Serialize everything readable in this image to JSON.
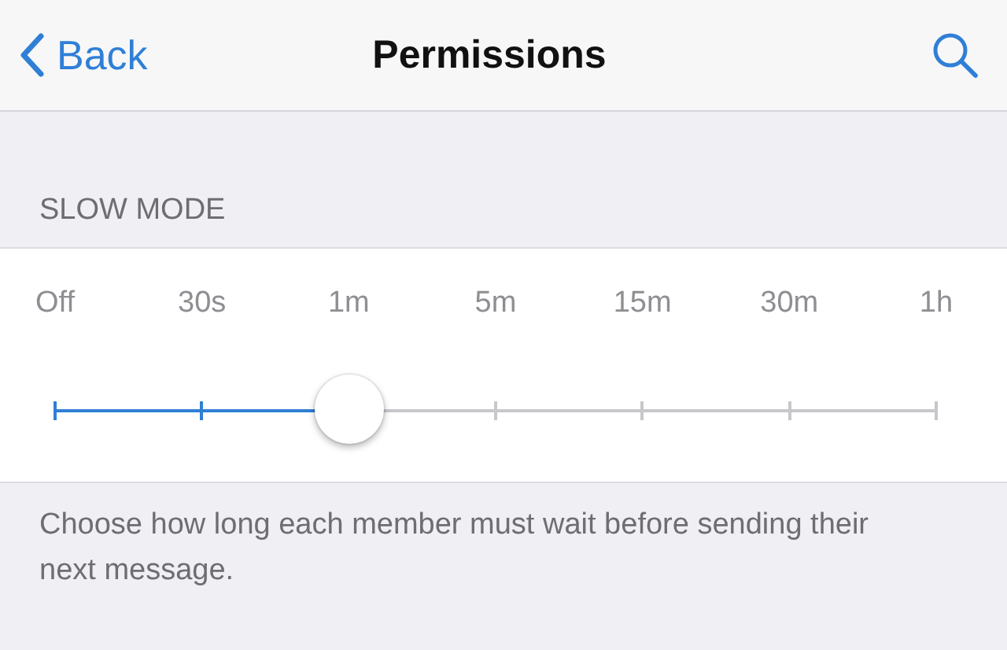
{
  "nav": {
    "back_label": "Back",
    "title": "Permissions"
  },
  "section": {
    "header": "SLOW MODE"
  },
  "slider": {
    "options": [
      "Off",
      "30s",
      "1m",
      "5m",
      "15m",
      "30m",
      "1h"
    ],
    "level": 0.3333
  },
  "footer": "Choose how long each member must wait before sending their next message."
}
